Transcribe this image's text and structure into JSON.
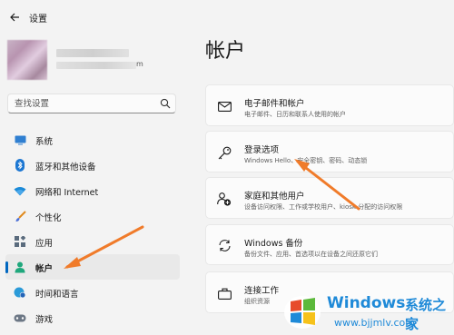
{
  "app": {
    "title": "设置"
  },
  "profile": {
    "email_suffix": "m"
  },
  "search": {
    "placeholder": "查找设置"
  },
  "nav": {
    "items": [
      {
        "label": "系统",
        "icon": "system-icon",
        "selected": false
      },
      {
        "label": "蓝牙和其他设备",
        "icon": "bluetooth-icon",
        "selected": false
      },
      {
        "label": "网络和 Internet",
        "icon": "wifi-icon",
        "selected": false
      },
      {
        "label": "个性化",
        "icon": "brush-icon",
        "selected": false
      },
      {
        "label": "应用",
        "icon": "apps-icon",
        "selected": false
      },
      {
        "label": "帐户",
        "icon": "account-icon",
        "selected": true
      },
      {
        "label": "时间和语言",
        "icon": "globe-clock-icon",
        "selected": false
      },
      {
        "label": "游戏",
        "icon": "gamepad-icon",
        "selected": false
      }
    ]
  },
  "main": {
    "title": "帐户",
    "cards": [
      {
        "title": "电子邮件和帐户",
        "subtitle": "电子邮件、日历和联系人使用的帐户",
        "icon": "mail-icon"
      },
      {
        "title": "登录选项",
        "subtitle": "Windows Hello、安全密钥、密码、动态锁",
        "icon": "key-icon"
      },
      {
        "title": "家庭和其他用户",
        "subtitle": "设备访问权限、工作或学校用户、kiosk 分配的访问权限",
        "icon": "family-add-icon"
      },
      {
        "title": "Windows 备份",
        "subtitle": "备份文件、应用、首选项以在设备之间还原它们",
        "icon": "backup-sync-icon"
      },
      {
        "title": "连接工作",
        "subtitle": "组织资源",
        "icon": "briefcase-icon"
      }
    ]
  },
  "watermark": {
    "brand": "Windows",
    "brand_cn": "系统之家",
    "url": "www.bjjmlv.com"
  },
  "colors": {
    "accent": "#0067c0",
    "arrow": "#f07b2a",
    "watermark": "#1f8ad8"
  }
}
